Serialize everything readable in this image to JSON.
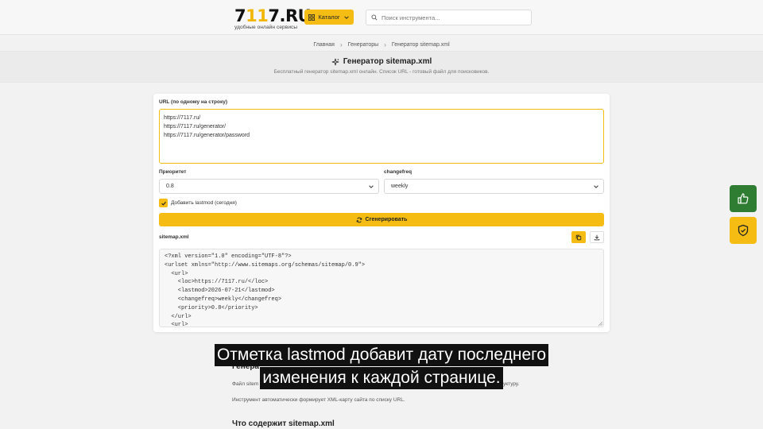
{
  "header": {
    "logo_prefix": "7",
    "logo_accent": "11",
    "logo_suffix": "7.RU",
    "logo_sub": "удобные онлайн сервисы",
    "catalog_label": "Каталог",
    "search_placeholder": "Поиск инструмента..."
  },
  "breadcrumbs": [
    "Главная",
    "Генераторы",
    "Генератор sitemap.xml"
  ],
  "hero": {
    "title": "Генератор sitemap.xml",
    "subtitle": "Бесплатный генератор sitemap.xml онлайн. Список URL - готовый файл для поисковиков."
  },
  "form": {
    "url_label": "URL (по одному на строку)",
    "url_value": "https://7117.ru/\nhttps://7117.ru/generator/\nhttps://7117.ru/generator/password",
    "priority_label": "Приоритет",
    "priority_value": "0.8",
    "changefreq_label": "changefreq",
    "changefreq_value": "weekly",
    "lastmod_label": "Добавить lastmod (сегодня)",
    "lastmod_checked": true,
    "generate_label": "Сгенерировать",
    "output_label": "sitemap.xml",
    "output_xml": "<?xml version=\"1.0\" encoding=\"UTF-8\"?>\n<urlset xmlns=\"http://www.sitemaps.org/schemas/sitemap/0.9\">\n  <url>\n    <loc>https://7117.ru/</loc>\n    <lastmod>2026-07-21</lastmod>\n    <changefreq>weekly</changefreq>\n    <priority>0.8</priority>\n  </url>\n  <url>"
  },
  "below": {
    "heading_partial": "Генера",
    "para1_start": "Файл sitem",
    "para1_end": "уктуру.",
    "para2": "Инструмент автоматически формирует XML-карту сайта по списку URL.",
    "heading2": "Что содержит sitemap.xml"
  },
  "subtitles": {
    "line1": "Отметка lastmod добавит дату последнего",
    "line2": "изменения к каждой странице."
  },
  "colors": {
    "accent": "#f5bd13",
    "like_button": "#2e7d32",
    "shield_button": "#f5bd13"
  },
  "icons": {
    "catalog": "grid-icon",
    "search": "search-icon",
    "hero": "sparkle-icon",
    "generate": "refresh-icon",
    "copy": "copy-icon",
    "download": "download-icon",
    "like": "thumbs-up-icon",
    "shield": "shield-check-icon"
  }
}
